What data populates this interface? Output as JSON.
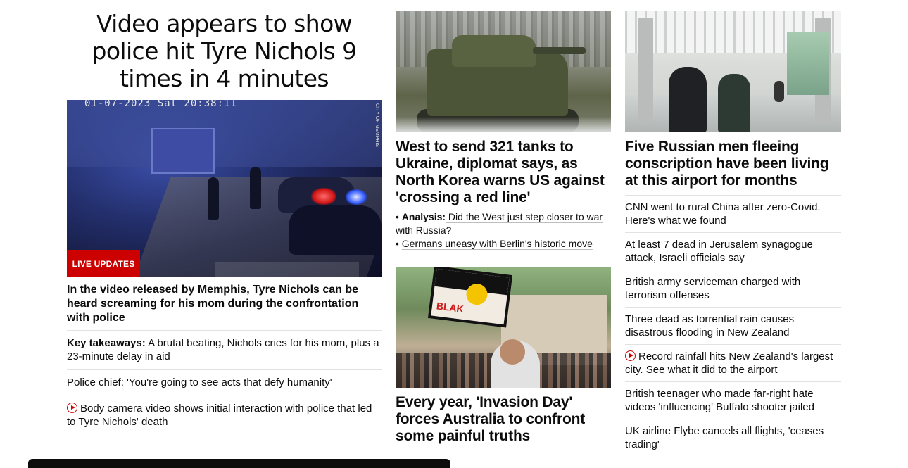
{
  "lead": {
    "headline": "Video appears to show police hit Tyre Nichols 9 times in 4 minutes",
    "image": {
      "timestamp": "01-07-2023 Sat 20:38:11",
      "credit": "CITY OF MEMPHIS",
      "badge": "LIVE UPDATES"
    },
    "caption": "In the video released by Memphis, Tyre Nichols can be heard screaming for his mom during the confrontation with police",
    "list": [
      {
        "prefix": "Key takeaways:",
        "text": " A brutal beating, Nichols cries for his mom, plus a 23-minute delay in aid"
      },
      {
        "text": "Police chief: 'You're going to see acts that defy humanity'"
      },
      {
        "icon": "play-icon",
        "text": "Body camera video shows initial interaction with police that led to Tyre Nichols' death"
      }
    ]
  },
  "middle": {
    "story1": {
      "headline": "West to send 321 tanks to Ukraine, diplomat says, as North Korea warns US against 'crossing a red line'",
      "related": [
        {
          "prefix": "Analysis:",
          "text": " Did the West just step closer to war with Russia?"
        },
        {
          "text": "Germans uneasy with Berlin's historic move"
        }
      ]
    },
    "story2": {
      "headline": "Every year, 'Invasion Day' forces Australia to confront some painful truths",
      "sign_text": "BLAK"
    }
  },
  "right": {
    "headline": "Five Russian men fleeing conscription have been living at this airport for months",
    "list": [
      {
        "text": "CNN went to rural China after zero-Covid. Here's what we found"
      },
      {
        "text": "At least 7 dead in Jerusalem synagogue attack, Israeli officials say"
      },
      {
        "text": "British army serviceman charged with terrorism offenses"
      },
      {
        "text": "Three dead as torrential rain causes disastrous flooding in New Zealand"
      },
      {
        "icon": "play-icon",
        "text": "Record rainfall hits New Zealand's largest city. See what it did to the airport"
      },
      {
        "text": "British teenager who made far-right hate videos 'influencing' Buffalo shooter jailed"
      },
      {
        "text": "UK airline Flybe cancels all flights, 'ceases trading'"
      }
    ]
  },
  "colors": {
    "accent_red": "#cc0000",
    "text": "#0c0c0c",
    "divider": "#e2e2e2"
  }
}
